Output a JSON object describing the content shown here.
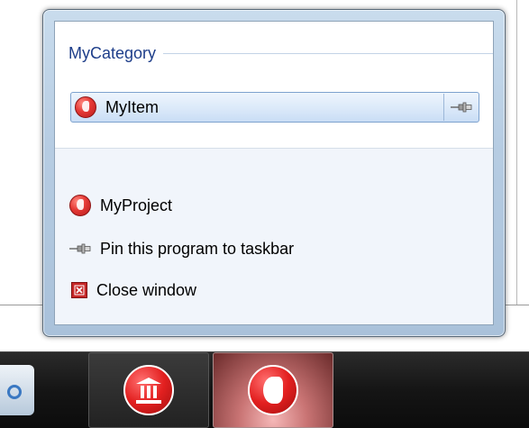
{
  "jump_list": {
    "category": {
      "title": "MyCategory",
      "items": [
        {
          "label": "MyItem",
          "icon": "app-helmet-icon",
          "pin_icon": "pin-icon"
        }
      ]
    },
    "tasks": [
      {
        "label": "MyProject",
        "icon": "app-helmet-icon"
      },
      {
        "label": "Pin this program to taskbar",
        "icon": "pin-icon"
      },
      {
        "label": "Close window",
        "icon": "close-window-icon"
      }
    ]
  },
  "taskbar": {
    "buttons": [
      {
        "icon": "media-player-icon"
      },
      {
        "icon": "temple-app-icon"
      },
      {
        "icon": "app-helmet-icon",
        "active": true
      }
    ]
  },
  "colors": {
    "category_text": "#1e3e8a",
    "hover_border": "#7da2ce",
    "app_red": "#e53935",
    "taskbar_bg": "#151515"
  }
}
